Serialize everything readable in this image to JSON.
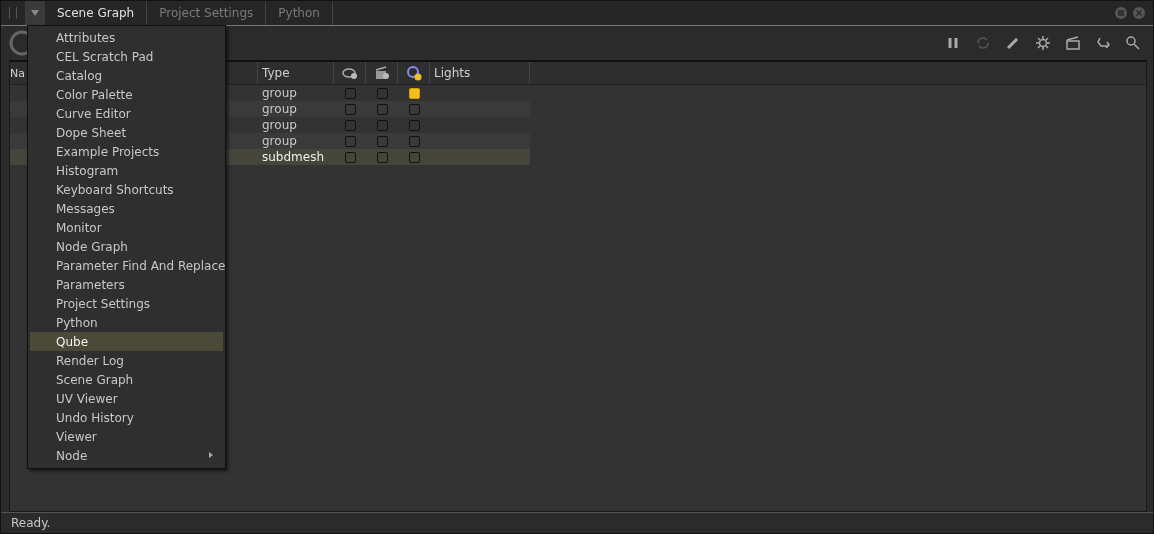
{
  "tabs": [
    {
      "label": "Scene Graph",
      "selected": true
    },
    {
      "label": "Project Settings",
      "selected": false
    },
    {
      "label": "Python",
      "selected": false
    }
  ],
  "table": {
    "columns": [
      "Na",
      "Type",
      "Lights"
    ],
    "rows": [
      {
        "type": "group",
        "checks": [
          false,
          false,
          true
        ],
        "selected": false
      },
      {
        "type": "group",
        "checks": [
          false,
          false,
          false
        ],
        "selected": false
      },
      {
        "type": "group",
        "checks": [
          false,
          false,
          false
        ],
        "selected": false
      },
      {
        "type": "group",
        "checks": [
          false,
          false,
          false
        ],
        "selected": false
      },
      {
        "type": "subdmesh",
        "checks": [
          false,
          false,
          false
        ],
        "selected": true
      }
    ]
  },
  "menu": {
    "items": [
      {
        "label": "Attributes",
        "selected": false
      },
      {
        "label": "CEL Scratch Pad",
        "selected": false
      },
      {
        "label": "Catalog",
        "selected": false
      },
      {
        "label": "Color Palette",
        "selected": false
      },
      {
        "label": "Curve Editor",
        "selected": false
      },
      {
        "label": "Dope Sheet",
        "selected": false
      },
      {
        "label": "Example Projects",
        "selected": false
      },
      {
        "label": "Histogram",
        "selected": false
      },
      {
        "label": "Keyboard Shortcuts",
        "selected": false
      },
      {
        "label": "Messages",
        "selected": false
      },
      {
        "label": "Monitor",
        "selected": false
      },
      {
        "label": "Node Graph",
        "selected": false
      },
      {
        "label": "Parameter Find And Replace",
        "selected": false
      },
      {
        "label": "Parameters",
        "selected": false
      },
      {
        "label": "Project Settings",
        "selected": false
      },
      {
        "label": "Python",
        "selected": false
      },
      {
        "label": "Qube",
        "selected": true
      },
      {
        "label": "Render Log",
        "selected": false
      },
      {
        "label": "Scene Graph",
        "selected": false
      },
      {
        "label": "UV Viewer",
        "selected": false
      },
      {
        "label": "Undo History",
        "selected": false
      },
      {
        "label": "Viewer",
        "selected": false
      },
      {
        "label": "Node",
        "selected": false,
        "submenu": true
      }
    ]
  },
  "status_bar": "Ready."
}
